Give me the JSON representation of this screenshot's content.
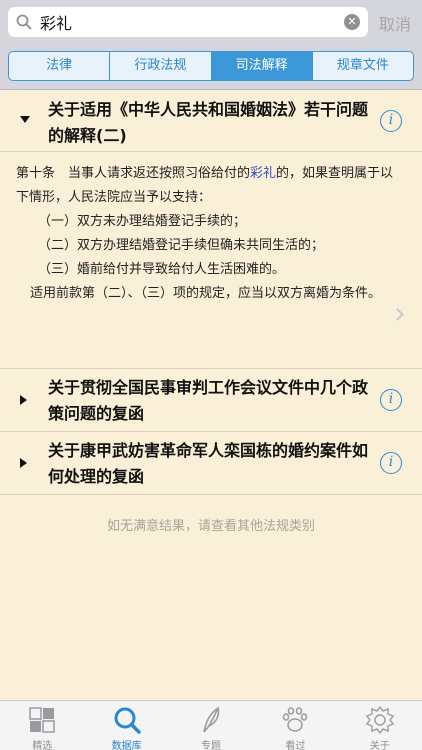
{
  "search": {
    "value": "彩礼",
    "clear_glyph": "✕",
    "cancel_label": "取消"
  },
  "segments": [
    {
      "label": "法律",
      "active": false
    },
    {
      "label": "行政法规",
      "active": false
    },
    {
      "label": "司法解释",
      "active": true
    },
    {
      "label": "规章文件",
      "active": false
    }
  ],
  "results": [
    {
      "title": "关于适用《中华人民共和国婚姻法》若干问题的解释(二)",
      "expanded": true,
      "info_glyph": "i"
    },
    {
      "title": "关于贯彻全国民事审判工作会议文件中几个政策问题的复函",
      "expanded": false,
      "info_glyph": "i"
    },
    {
      "title": "关于康甲武妨害革命军人栾国栋的婚约案件如何处理的复函",
      "expanded": false,
      "info_glyph": "i"
    }
  ],
  "article": {
    "intro_a": "第十条　当事人请求返还按照习俗给付的",
    "intro_hl": "彩礼",
    "intro_b": "的，如果查明属于以下情形，人民法院应当予以支持：",
    "item1": "（一）双方未办理结婚登记手续的；",
    "item2": "（二）双方办理结婚登记手续但确未共同生活的；",
    "item3": "（三）婚前给付并导致给付人生活困难的。",
    "closing": "适用前款第（二）、（三）项的规定，应当以双方离婚为条件。"
  },
  "footer_note": "如无满意结果，请查看其他法规类别",
  "tabs": [
    {
      "label": "精选",
      "icon": "grid-icon",
      "active": false
    },
    {
      "label": "数据库",
      "icon": "search-icon",
      "active": true
    },
    {
      "label": "专题",
      "icon": "leaf-icon",
      "active": false
    },
    {
      "label": "看过",
      "icon": "paw-icon",
      "active": false
    },
    {
      "label": "关于",
      "icon": "gear-icon",
      "active": false
    }
  ],
  "colors": {
    "accent": "#3c97d8",
    "background": "#faf0d7",
    "highlight": "#3347c7",
    "inactive": "#8e8e93"
  }
}
